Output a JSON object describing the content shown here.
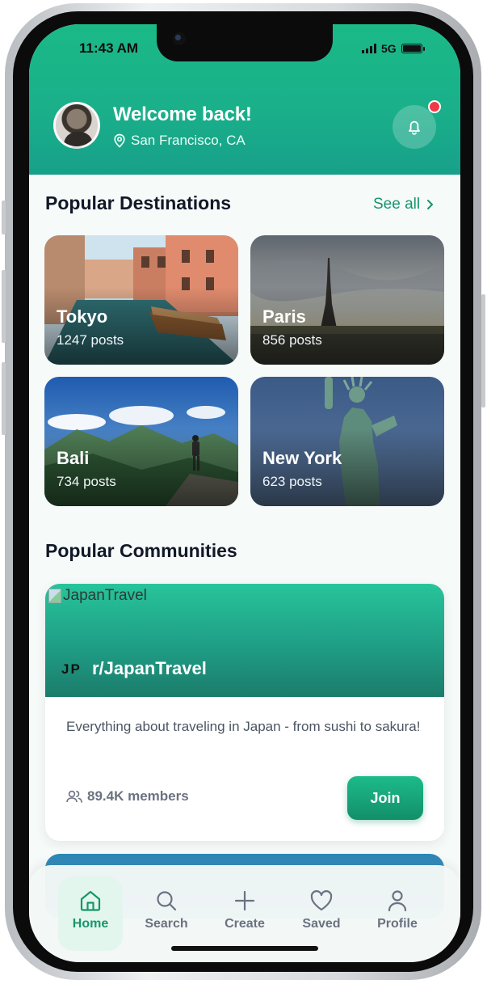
{
  "status_bar": {
    "time": "11:43 AM",
    "network": "5G"
  },
  "header": {
    "welcome": "Welcome back!",
    "location": "San Francisco, CA"
  },
  "destinations": {
    "title": "Popular Destinations",
    "see_all": "See all",
    "items": [
      {
        "name": "Tokyo",
        "posts": "1247 posts"
      },
      {
        "name": "Paris",
        "posts": "856 posts"
      },
      {
        "name": "Bali",
        "posts": "734 posts"
      },
      {
        "name": "New York",
        "posts": "623 posts"
      }
    ]
  },
  "communities": {
    "title": "Popular Communities",
    "items": [
      {
        "image_alt": "JapanTravel",
        "badge": "JP",
        "name": "r/JapanTravel",
        "description": "Everything about traveling in Japan - from sushi to sakura!",
        "members": "89.4K members",
        "join_label": "Join"
      }
    ]
  },
  "nav": {
    "items": [
      {
        "label": "Home",
        "icon": "home-icon",
        "active": true
      },
      {
        "label": "Search",
        "icon": "search-icon"
      },
      {
        "label": "Create",
        "icon": "plus-icon"
      },
      {
        "label": "Saved",
        "icon": "heart-icon"
      },
      {
        "label": "Profile",
        "icon": "user-icon"
      }
    ]
  },
  "colors": {
    "primary": "#1ab08a",
    "accent": "#16956d",
    "notification": "#ef3b47"
  }
}
